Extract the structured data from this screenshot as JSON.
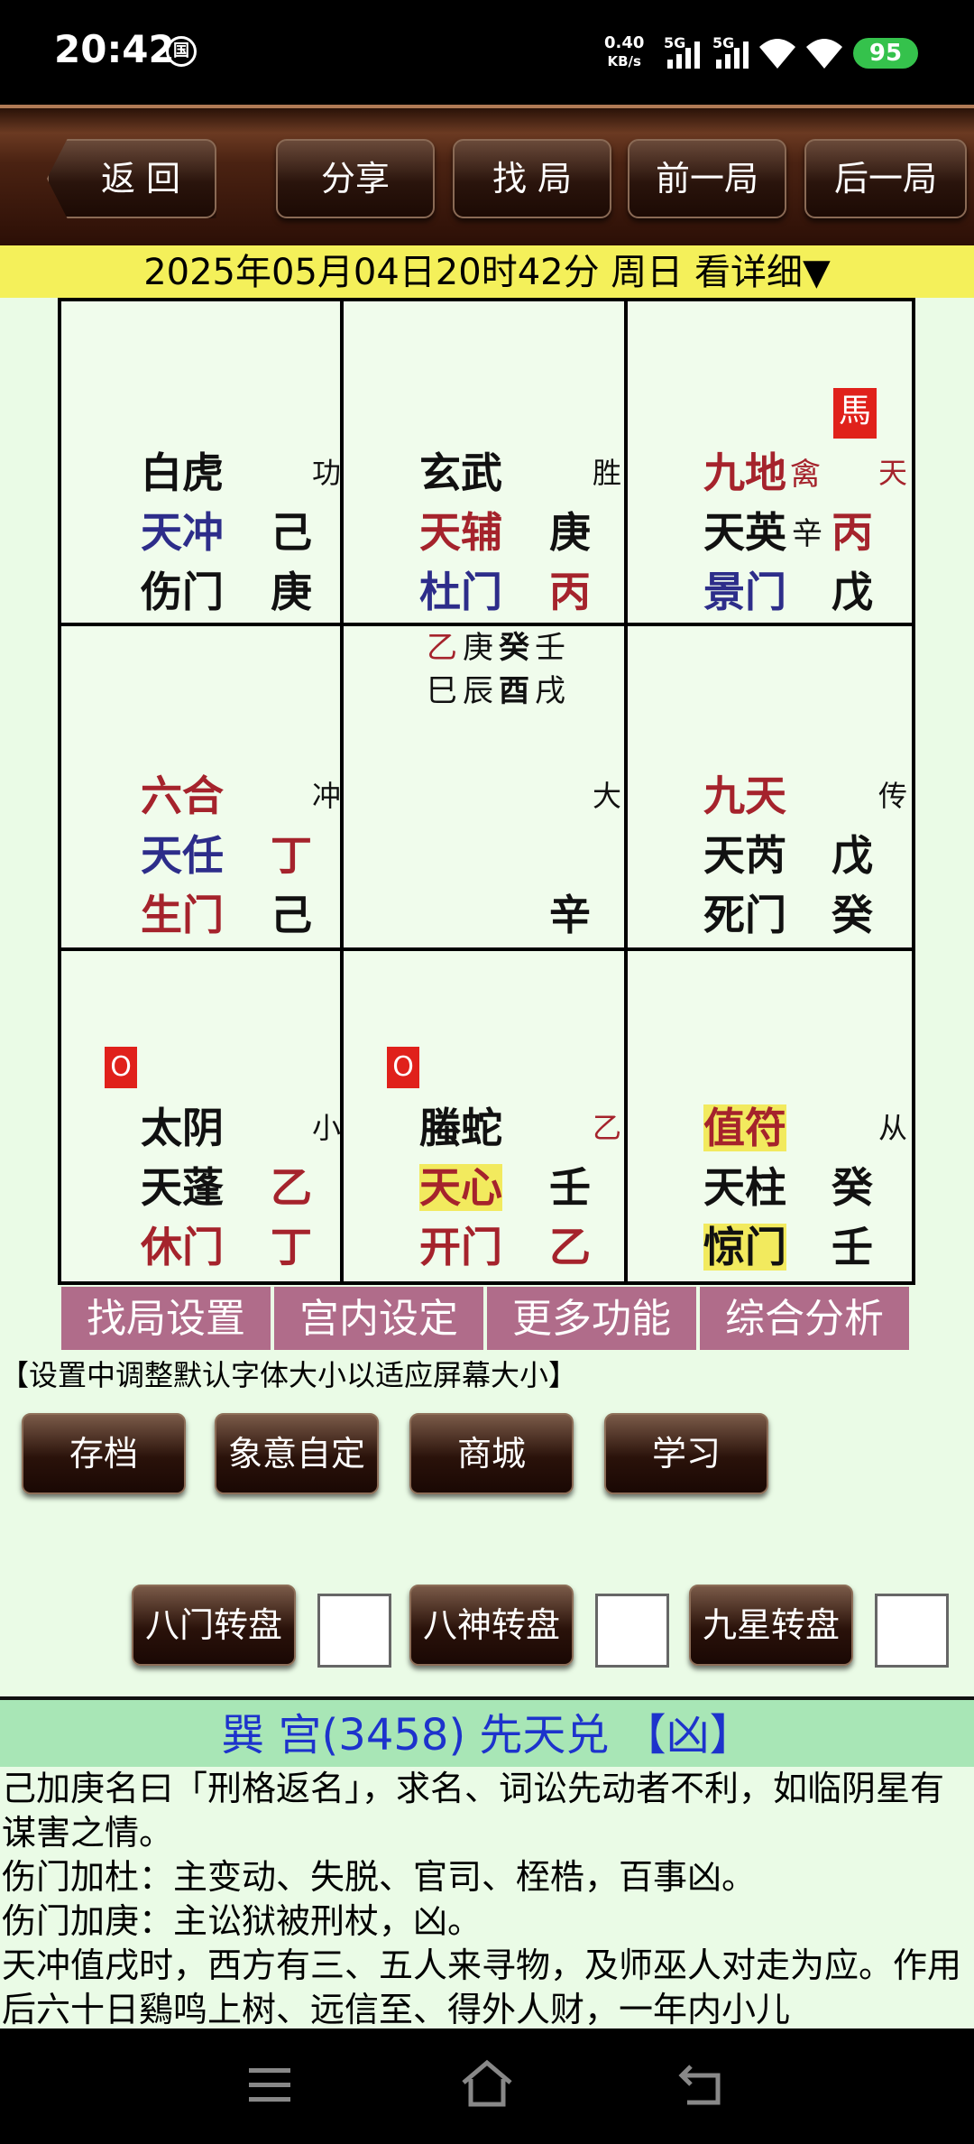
{
  "status": {
    "time": "20:42",
    "speed_top": "0.40",
    "speed_unit": "KB/s",
    "net1": "5G",
    "net2": "5G",
    "battery": "95"
  },
  "nav": {
    "back": "返 回",
    "share": "分享",
    "find": "找 局",
    "prev": "前一局",
    "next": "后一局"
  },
  "date_line": "2025年05月04日20时42分 周日 看详细▼",
  "palaces": {
    "c0": {
      "god": "白虎",
      "side": "功",
      "star": "天冲",
      "star_stem": "己",
      "door": "伤门",
      "door_stem": "庚"
    },
    "c1": {
      "god": "玄武",
      "side": "胜",
      "star": "天辅",
      "star_stem": "庚",
      "door": "杜门",
      "door_stem": "丙"
    },
    "c2": {
      "horse": "馬",
      "god": "九地",
      "god_extra": "禽",
      "side": "天",
      "star": "天英",
      "star_extra": "辛",
      "star_stem": "丙",
      "door": "景门",
      "door_stem": "戊"
    },
    "c3": {
      "god": "六合",
      "side": "冲",
      "star": "天任",
      "star_stem": "丁",
      "door": "生门",
      "door_stem": "己"
    },
    "c4": {
      "row1": [
        "乙",
        "庚",
        "癸",
        "壬"
      ],
      "row2": [
        "巳",
        "辰",
        "酉",
        "戌"
      ],
      "side": "大",
      "stem": "辛"
    },
    "c5": {
      "god": "九天",
      "side": "传",
      "star": "天芮",
      "star_stem": "戊",
      "door": "死门",
      "door_stem": "癸"
    },
    "c6": {
      "mark": "O",
      "god": "太阴",
      "side": "小",
      "star": "天蓬",
      "star_stem": "乙",
      "door": "休门",
      "door_stem": "丁"
    },
    "c7": {
      "mark": "O",
      "god": "螣蛇",
      "side": "乙",
      "star": "天心",
      "star_stem": "壬",
      "door": "开门",
      "door_stem": "乙"
    },
    "c8": {
      "god": "值符",
      "side": "从",
      "star": "天柱",
      "star_stem": "癸",
      "door": "惊门",
      "door_stem": "壬"
    }
  },
  "tabs": [
    "找局设置",
    "宫内设定",
    "更多功能",
    "综合分析"
  ],
  "note": "【设置中调整默认字体大小以适应屏幕大小】",
  "buttons": {
    "save": "存档",
    "custom": "象意自定",
    "shop": "商城",
    "study": "学习"
  },
  "rotate": {
    "door": "八门转盘",
    "god": "八神转盘",
    "star": "九星转盘"
  },
  "section_title": "巽 宫(3458) 先天兑 【凶】",
  "desc": [
    "己加庚名曰「刑格返名」，求名、词讼先动者不利，如临阴星有谋害之情。",
    "伤门加杜：主变动、失脱、官司、桎梏，百事凶。",
    "伤门加庚：主讼狱被刑杖，凶。",
    "天冲值戌时，西方有三、五人来寻物，及师巫人对走为应。作用后六十日鷄鸣上树、远信至、得外人财，一年内小儿"
  ]
}
